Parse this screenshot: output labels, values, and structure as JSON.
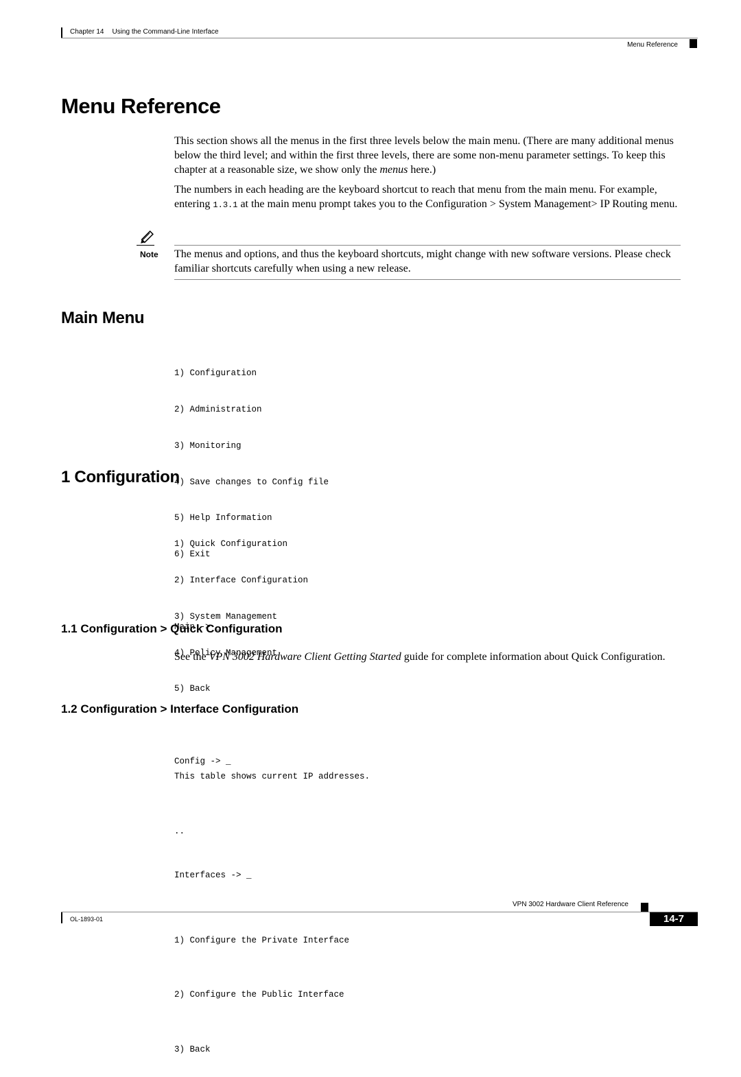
{
  "header": {
    "chapter": "Chapter 14",
    "chapter_title": "Using the Command-Line Interface",
    "section": "Menu Reference"
  },
  "title": "Menu Reference",
  "intro": {
    "p1": "This section shows all the menus in the first three levels below the main menu. (There are many additional menus below the third level; and within the first three levels, there are some non-menu parameter settings. To keep this chapter at a reasonable size, we show only the ",
    "p1_em": "menus",
    "p1_end": " here.)",
    "p2_start": "The numbers in each heading are the keyboard shortcut to reach that menu from the main menu. For example, entering ",
    "p2_code": "1.3.1",
    "p2_end": " at the main menu prompt takes you to the Configuration > System Management> IP Routing menu."
  },
  "note": {
    "label": "Note",
    "text": "The menus and options, and thus the keyboard shortcuts, might change with new software versions. Please check familiar shortcuts carefully when using a new release."
  },
  "main_menu": {
    "heading": "Main Menu",
    "items": [
      "1) Configuration",
      "2) Administration",
      "3) Monitoring",
      "4) Save changes to Config file",
      "5) Help Information",
      "6) Exit"
    ],
    "prompt": "Main -> _"
  },
  "configuration": {
    "heading": "1 Configuration",
    "items": [
      "1) Quick Configuration",
      "2) Interface Configuration",
      "3) System Management",
      "4) Policy Management",
      "5) Back"
    ],
    "prompt": "Config -> _"
  },
  "quick_config": {
    "heading": "1.1 Configuration > Quick Configuration",
    "text_start": "See the ",
    "text_em": "VPN 3002 Hardware Client Getting Started",
    "text_end": " guide for complete information about Quick Configuration."
  },
  "interface_config": {
    "heading": "1.2 Configuration > Interface Configuration",
    "intro": "This table shows current IP addresses.",
    "ellipsis": "..",
    "items": [
      "1) Configure the Private Interface",
      "2) Configure the Public Interface",
      "3) Back"
    ],
    "prompt": "Interfaces -> _"
  },
  "footer": {
    "book_title": "VPN 3002 Hardware Client Reference",
    "doc_number": "OL-1893-01",
    "page_number": "14-7"
  }
}
